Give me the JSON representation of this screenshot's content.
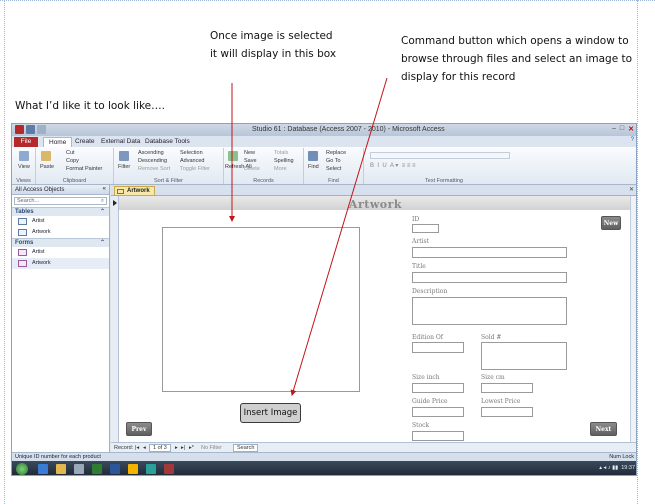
{
  "notes": {
    "image_box_note_line1": "Once image is selected",
    "image_box_note_line2": "it will display in this box",
    "command_note_line1": "Command button which opens a window to",
    "command_note_line2": "browse through  files and select an image to",
    "command_note_line3": "display for this record",
    "look_like": "What I’d like it to look like…."
  },
  "app": {
    "title": "Studio 61 : Database (Access 2007 - 2010) - Microsoft Access",
    "tabs": [
      "File",
      "Home",
      "Create",
      "External Data",
      "Database Tools"
    ],
    "active_tab": "Home"
  },
  "ribbon": {
    "views": {
      "view_label": "View",
      "group": "Views"
    },
    "clipboard": {
      "paste": "Paste",
      "cut": "Cut",
      "copy": "Copy",
      "format_painter": "Format Painter",
      "group": "Clipboard"
    },
    "sort_filter": {
      "filter": "Filter",
      "ascending": "Ascending",
      "descending": "Descending",
      "remove_sort": "Remove Sort",
      "selection": "Selection",
      "advanced": "Advanced",
      "toggle_filter": "Toggle Filter",
      "group": "Sort & Filter"
    },
    "records": {
      "refresh": "Refresh All",
      "new": "New",
      "save": "Save",
      "delete": "Delete",
      "totals": "Totals",
      "spelling": "Spelling",
      "more": "More",
      "group": "Records"
    },
    "find": {
      "find": "Find",
      "replace": "Replace",
      "goto": "Go To",
      "select": "Select",
      "group": "Find"
    },
    "text_formatting": {
      "group": "Text Formatting"
    }
  },
  "nav_pane": {
    "header": "All Access Objects",
    "search_placeholder": "Search...",
    "groups": [
      {
        "name": "Tables",
        "items": [
          "Artist",
          "Artwork"
        ]
      },
      {
        "name": "Forms",
        "items": [
          "Artist",
          "Artwork"
        ]
      }
    ]
  },
  "document_tab": "Artwork",
  "form": {
    "title": "Artwork",
    "labels": {
      "id": "ID",
      "artist": "Artist",
      "title": "Title",
      "description": "Description",
      "edition_of": "Edition Of",
      "sold": "Sold #",
      "size_inch": "Size inch",
      "size_cm": "Size cm",
      "guide_price": "Guide Price",
      "lowest_price": "Lowest Price",
      "stock": "Stock"
    },
    "buttons": {
      "new": "New",
      "prev": "Prev",
      "next": "Next",
      "insert_image": "Insert Image"
    }
  },
  "record_nav": {
    "record_label": "Record:",
    "position": "1 of 3",
    "no_filter": "No Filter",
    "search": "Search"
  },
  "status": {
    "left": "Unique ID number for each product",
    "right": "Num Lock"
  },
  "taskbar": {
    "time": "19:37"
  },
  "colors": {
    "file_tab": "#b5282c",
    "form_header": "#d2d2d2",
    "nav_header_text": "#2c4a78"
  }
}
